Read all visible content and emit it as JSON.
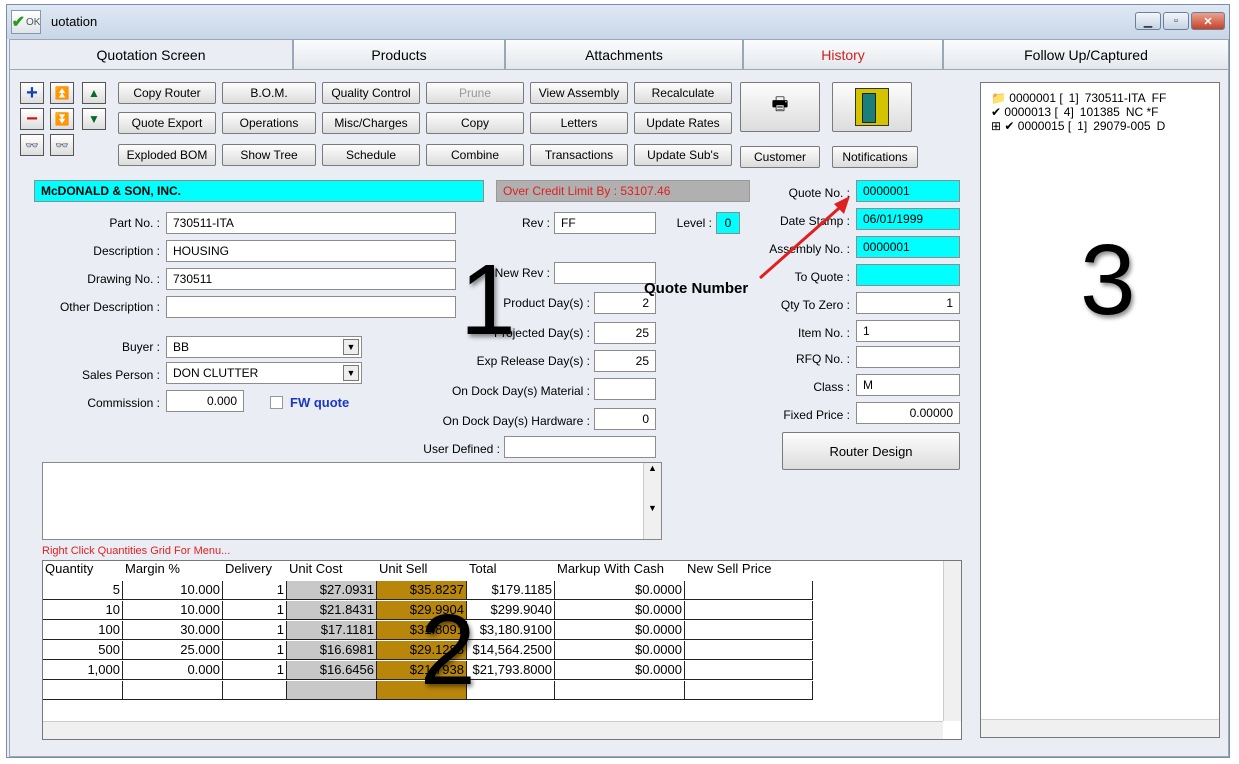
{
  "window": {
    "ok_label": "OK",
    "title": "uotation"
  },
  "tabs": [
    "Quotation Screen",
    "Products",
    "Attachments",
    "History",
    "Follow Up/Captured"
  ],
  "toolbar": {
    "row1": [
      "Copy Router",
      "B.O.M.",
      "Quality Control",
      "Prune",
      "View Assembly",
      "Recalculate"
    ],
    "row2": [
      "Quote Export",
      "Operations",
      "Misc/Charges",
      "Copy",
      "Letters",
      "Update Rates"
    ],
    "row3": [
      "Exploded BOM",
      "Show Tree",
      "Schedule",
      "Combine",
      "Transactions",
      "Update Sub's"
    ],
    "customer": "Customer",
    "notifications": "Notifications"
  },
  "customer_name": "McDONALD & SON, INC.",
  "credit_warning": "Over Credit Limit By : 53107.46",
  "left": {
    "part_no_label": "Part No. :",
    "part_no": "730511-ITA",
    "description_label": "Description :",
    "description": "HOUSING",
    "drawing_no_label": "Drawing No. :",
    "drawing_no": "730511",
    "other_desc_label": "Other Description :",
    "other_desc": "",
    "buyer_label": "Buyer :",
    "buyer": "BB",
    "sales_label": "Sales Person :",
    "sales": "DON CLUTTER",
    "commission_label": "Commission :",
    "commission": "0.000",
    "fw_quote": "FW quote"
  },
  "mid": {
    "rev_label": "Rev :",
    "rev": "FF",
    "level_label": "Level :",
    "level": "0",
    "new_rev_label": "New Rev :",
    "new_rev": "",
    "product_days_label": "Product Day(s) :",
    "product_days": "2",
    "projected_days_label": "Projected Day(s) :",
    "projected_days": "25",
    "exp_release_label": "Exp Release Day(s) :",
    "exp_release": "25",
    "dock_material_label": "On Dock Day(s) Material :",
    "dock_material": "",
    "dock_hardware_label": "On Dock Day(s) Hardware :",
    "dock_hardware": "0",
    "user_defined_label": "User Defined :",
    "user_defined": ""
  },
  "right": {
    "quote_no_label": "Quote No. :",
    "quote_no": "0000001",
    "date_label": "Date Stamp :",
    "date": "06/01/1999",
    "assembly_label": "Assembly No. :",
    "assembly": "0000001",
    "to_quote_label": "To Quote :",
    "to_quote": "",
    "qty_zero_label": "Qty To Zero :",
    "qty_zero": "1",
    "item_label": "Item No. :",
    "item": "1",
    "rfq_label": "RFQ No. :",
    "rfq": "",
    "class_label": "Class :",
    "class": "M",
    "fixed_label": "Fixed Price :",
    "fixed": "0.00000",
    "router_design": "Router Design"
  },
  "annotation": {
    "quote_number": "Quote Number",
    "one": "1",
    "two": "2",
    "three": "3"
  },
  "grid_hint": "Right Click Quantities Grid For Menu...",
  "grid": {
    "headers": [
      "Quantity",
      "Margin %",
      "Delivery",
      "Unit Cost",
      "Unit Sell",
      "Total",
      "Markup With Cash",
      "New Sell Price"
    ],
    "rows": [
      [
        "5",
        "10.000",
        "1",
        "$27.0931",
        "$35.8237",
        "$179.1185",
        "$0.0000"
      ],
      [
        "10",
        "10.000",
        "1",
        "$21.8431",
        "$29.9904",
        "$299.9040",
        "$0.0000"
      ],
      [
        "100",
        "30.000",
        "1",
        "$17.1181",
        "$31.8091",
        "$3,180.9100",
        "$0.0000"
      ],
      [
        "500",
        "25.000",
        "1",
        "$16.6981",
        "$29.1285",
        "$14,564.2500",
        "$0.0000"
      ],
      [
        "1,000",
        "0.000",
        "1",
        "$16.6456",
        "$21.7938",
        "$21,793.8000",
        "$0.0000"
      ]
    ]
  },
  "tree": [
    {
      "id": "0000001 [",
      "qty": "1]",
      "part": "730511-ITA",
      "rev": "FF"
    },
    {
      "id": "0000013 [",
      "qty": "4]",
      "part": "101385",
      "rev": "NC *F"
    },
    {
      "id": "0000015 [",
      "qty": "1]",
      "part": "29079-005",
      "rev": "D"
    }
  ],
  "colors": {
    "cyan": "#00ffff",
    "gold": "#b8860b",
    "gray": "#c8c8c8",
    "red": "#d02020"
  }
}
